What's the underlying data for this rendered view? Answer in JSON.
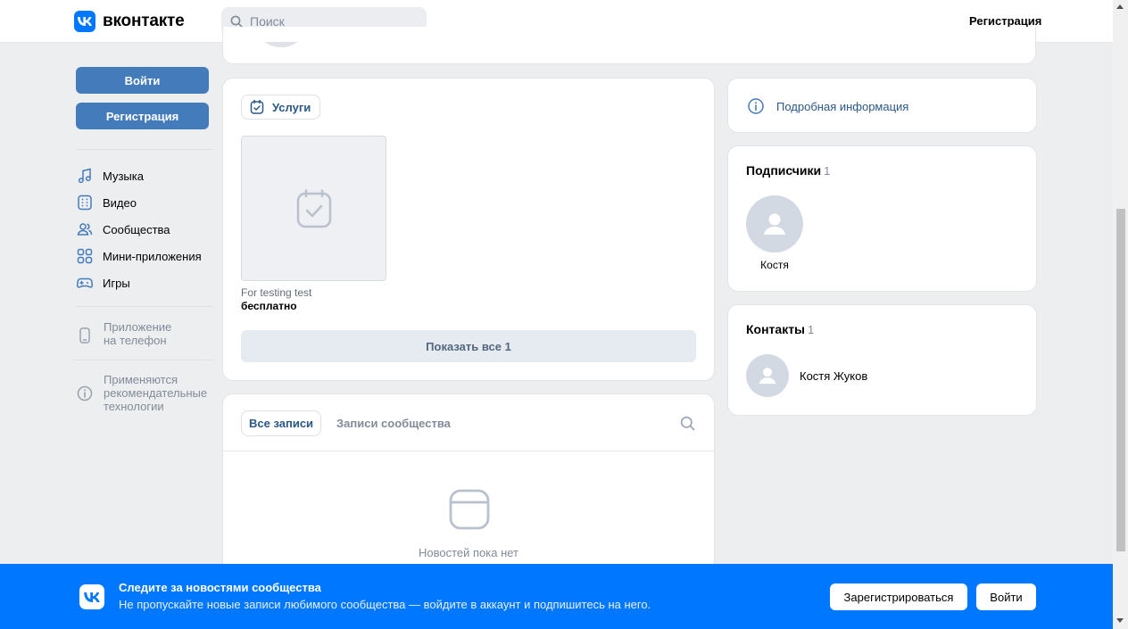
{
  "header": {
    "logo_text": "вконтакте",
    "search_placeholder": "Поиск",
    "register_label": "Регистрация"
  },
  "sidebar": {
    "login_button": "Войти",
    "register_button": "Регистрация",
    "nav": [
      {
        "label": "Музыка",
        "icon": "music-icon"
      },
      {
        "label": "Видео",
        "icon": "video-icon"
      },
      {
        "label": "Сообщества",
        "icon": "communities-icon"
      },
      {
        "label": "Мини-приложения",
        "icon": "mini-apps-icon"
      },
      {
        "label": "Игры",
        "icon": "games-icon"
      }
    ],
    "phone_app": {
      "line1": "Приложение",
      "line2": "на телефон",
      "icon": "phone-icon"
    },
    "recommend": {
      "line1": "Применяются",
      "line2": "рекомендательные",
      "line3": "технологии",
      "icon": "info-icon"
    }
  },
  "services": {
    "chip_label": "Услуги",
    "item": {
      "name": "For testing test",
      "price": "бесплатно"
    },
    "show_all": "Показать все 1"
  },
  "posts": {
    "tab_all": "Все записи",
    "tab_community": "Записи сообщества",
    "empty_text": "Новостей пока нет"
  },
  "info": {
    "label": "Подробная информация"
  },
  "subscribers": {
    "title": "Подписчики",
    "count": "1",
    "items": [
      {
        "name": "Костя"
      }
    ]
  },
  "contacts": {
    "title": "Контакты",
    "count": "1",
    "items": [
      {
        "name": "Костя Жуков"
      }
    ]
  },
  "banner": {
    "title": "Следите за новостями сообщества",
    "subtitle": "Не пропускайте новые записи любимого сообщества — войдите в аккаунт и подпишитесь на него.",
    "register_button": "Зарегистрироваться",
    "login_button": "Войти"
  },
  "colors": {
    "brand": "#0077ff",
    "button_blue": "#447bba",
    "link": "#2a5885",
    "page_bg": "#edeef0"
  }
}
